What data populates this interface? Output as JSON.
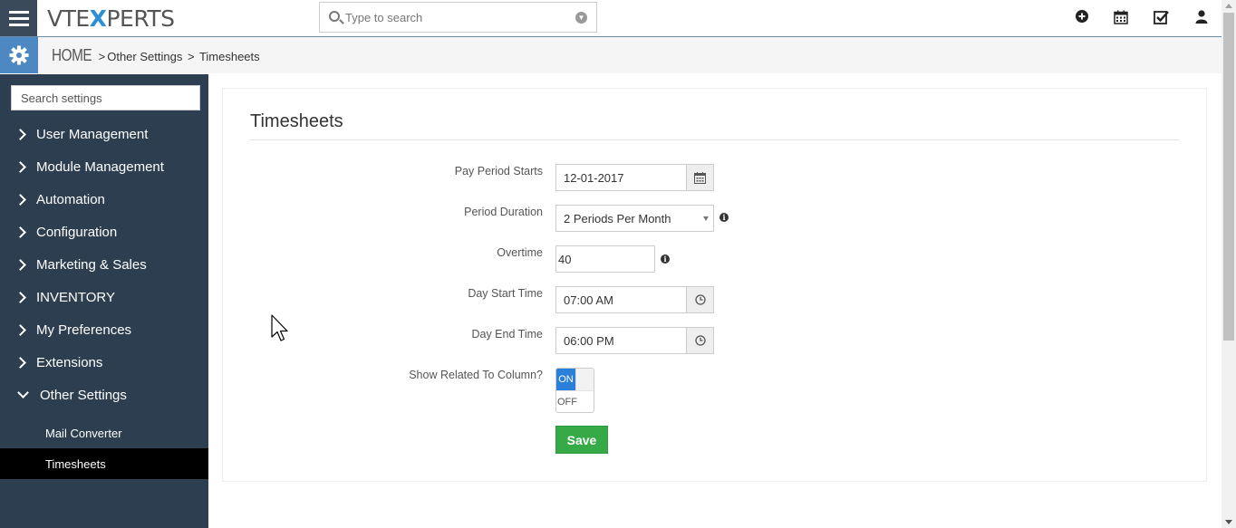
{
  "app": {
    "logo_prefix": "VTE",
    "logo_x": "X",
    "logo_suffix": "PERTS",
    "search_placeholder": "Type to search"
  },
  "breadcrumb": {
    "home": "HOME",
    "sep1": ">",
    "section": "Other Settings",
    "sep2": ">",
    "current": "Timesheets"
  },
  "sidebar": {
    "search_placeholder": "Search settings",
    "items": [
      {
        "label": "User Management",
        "expanded": false
      },
      {
        "label": "Module Management",
        "expanded": false
      },
      {
        "label": "Automation",
        "expanded": false
      },
      {
        "label": "Configuration",
        "expanded": false
      },
      {
        "label": "Marketing & Sales",
        "expanded": false
      },
      {
        "label": "INVENTORY",
        "expanded": false
      },
      {
        "label": "My Preferences",
        "expanded": false
      },
      {
        "label": "Extensions",
        "expanded": false
      },
      {
        "label": "Other Settings",
        "expanded": true
      }
    ],
    "subitems": [
      {
        "label": "Mail Converter",
        "active": false
      },
      {
        "label": "Timesheets",
        "active": true
      }
    ]
  },
  "form": {
    "title": "Timesheets",
    "pay_period_starts": {
      "label": "Pay Period Starts",
      "value": "12-01-2017"
    },
    "period_duration": {
      "label": "Period Duration",
      "value": "2 Periods Per Month"
    },
    "overtime": {
      "label": "Overtime",
      "value": "40"
    },
    "day_start_time": {
      "label": "Day Start Time",
      "value": "07:00 AM"
    },
    "day_end_time": {
      "label": "Day End Time",
      "value": "06:00 PM"
    },
    "show_related": {
      "label": "Show Related To Column?",
      "on_label": "ON",
      "off_label": "OFF",
      "state": "ON"
    },
    "save_label": "Save",
    "info_glyph": "i"
  },
  "colors": {
    "sidebar_bg": "#2c3e50",
    "active_item_bg": "#000000",
    "accent_blue": "#4e88c2",
    "toggle_on": "#2a7fd8",
    "save_green": "#35aa47"
  },
  "icons": {
    "top_right": [
      "plus-circle-icon",
      "calendar-icon",
      "task-check-icon",
      "user-icon"
    ]
  }
}
